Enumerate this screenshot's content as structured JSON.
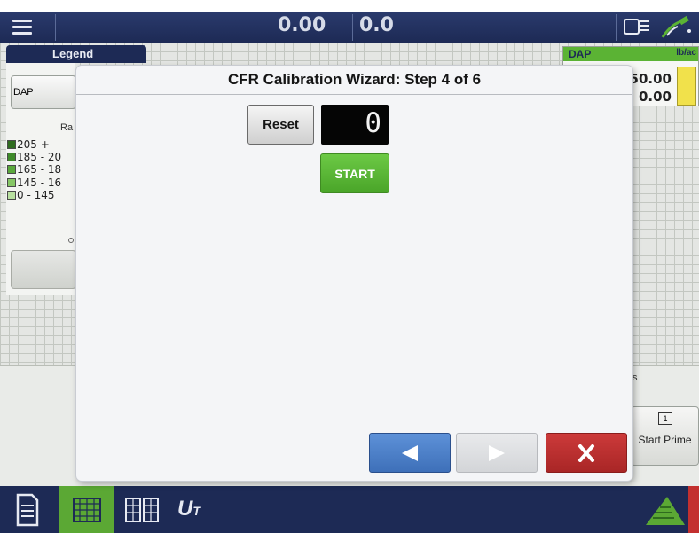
{
  "topbar": {
    "menu_icon": "hamburger-menu-icon",
    "value_left": "0.00",
    "value_right": "0.0",
    "status_icons": [
      "monitor-icon",
      "list-icon",
      "gps-satellite-icon"
    ]
  },
  "legend": {
    "tab_label": "Legend",
    "product_label": "DAP",
    "rate_header": "Ra",
    "ranges": [
      {
        "label": "205 +",
        "color": "#2f6b1f"
      },
      {
        "label": "185 - 20",
        "color": "#3f8a2a"
      },
      {
        "label": "165 - 18",
        "color": "#5aa83c"
      },
      {
        "label": "145 - 16",
        "color": "#86c766"
      },
      {
        "label": "0 - 145",
        "color": "#b8e0a0"
      }
    ],
    "button_icon": "settings-icon"
  },
  "product_panel": {
    "name": "DAP",
    "unit": "lb/ac",
    "target_rate": "50.00",
    "actual_rate": "0.00"
  },
  "side": {
    "partial_label": "s",
    "start_prime_label": "Start Prime",
    "start_prime_icon_text": "1"
  },
  "dialog": {
    "title": "CFR Calibration Wizard: Step 4 of 6",
    "reset_label": "Reset",
    "counter_value": "0",
    "start_label": "START",
    "prev_icon": "arrow-left-icon",
    "next_icon": "arrow-right-icon",
    "cancel_icon": "close-icon"
  },
  "bottombar": {
    "items": [
      "document-icon",
      "map-grid-icon",
      "split-grid-icon",
      "universal-terminal-icon",
      "field-icon"
    ],
    "ut_label": "U",
    "ut_sub": "T"
  },
  "colors": {
    "navy": "#1d2a55",
    "green": "#5ba834",
    "blue": "#3e70b9",
    "red": "#c3302f"
  }
}
